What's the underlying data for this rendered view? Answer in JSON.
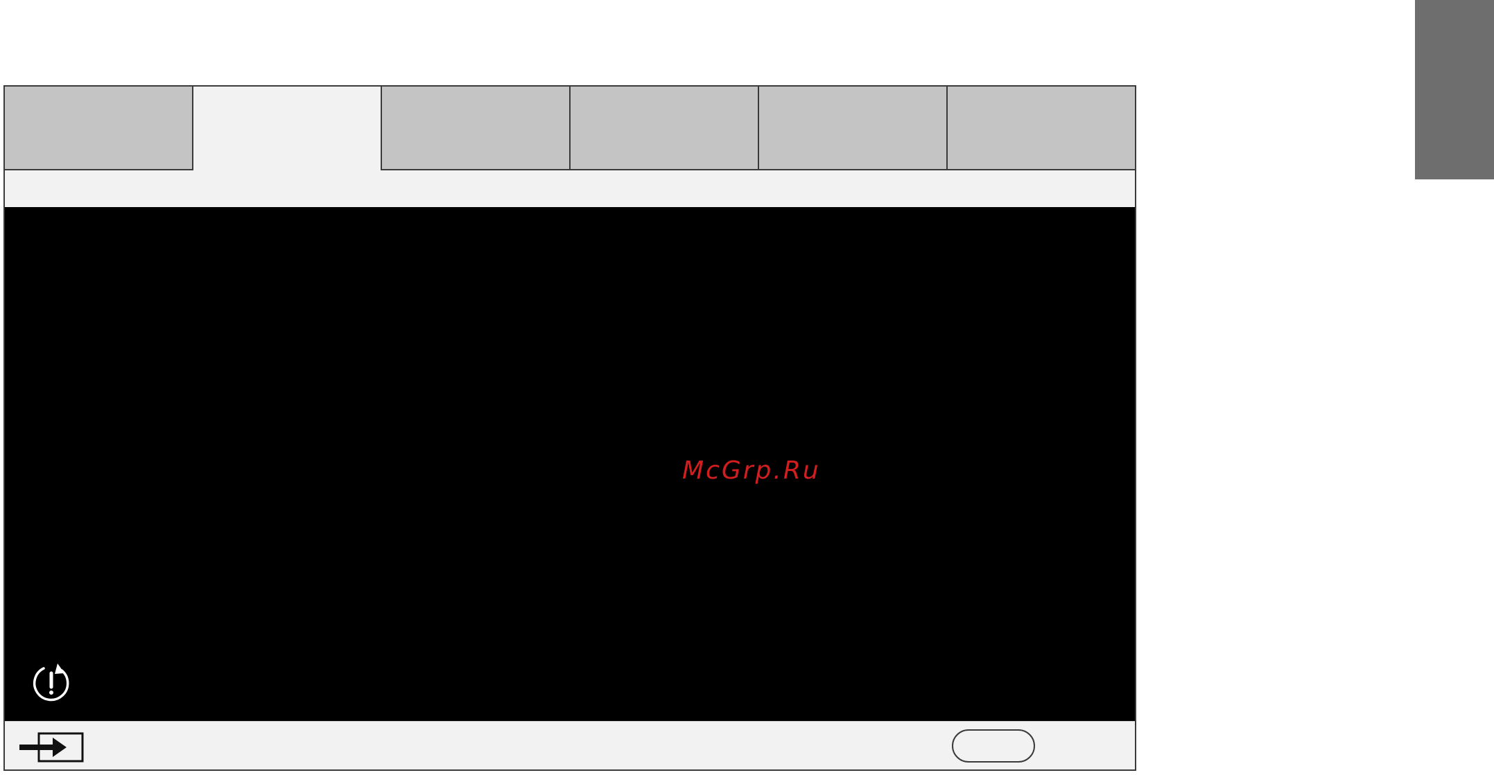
{
  "tabs": [
    {
      "label": ""
    },
    {
      "label": ""
    },
    {
      "label": ""
    },
    {
      "label": ""
    },
    {
      "label": ""
    },
    {
      "label": ""
    }
  ],
  "active_tab_index": 1,
  "content": {
    "watermark_text": "McGrp.Ru"
  },
  "icons": {
    "reset": "reset-icon",
    "input_source": "input-source-icon"
  },
  "footer": {
    "oval_button_label": ""
  },
  "colors": {
    "tab_inactive": "#c4c4c4",
    "tab_active": "#f2f2f2",
    "content_background": "#000000",
    "watermark": "#d21e1e",
    "side_block": "#6e6e6e"
  }
}
